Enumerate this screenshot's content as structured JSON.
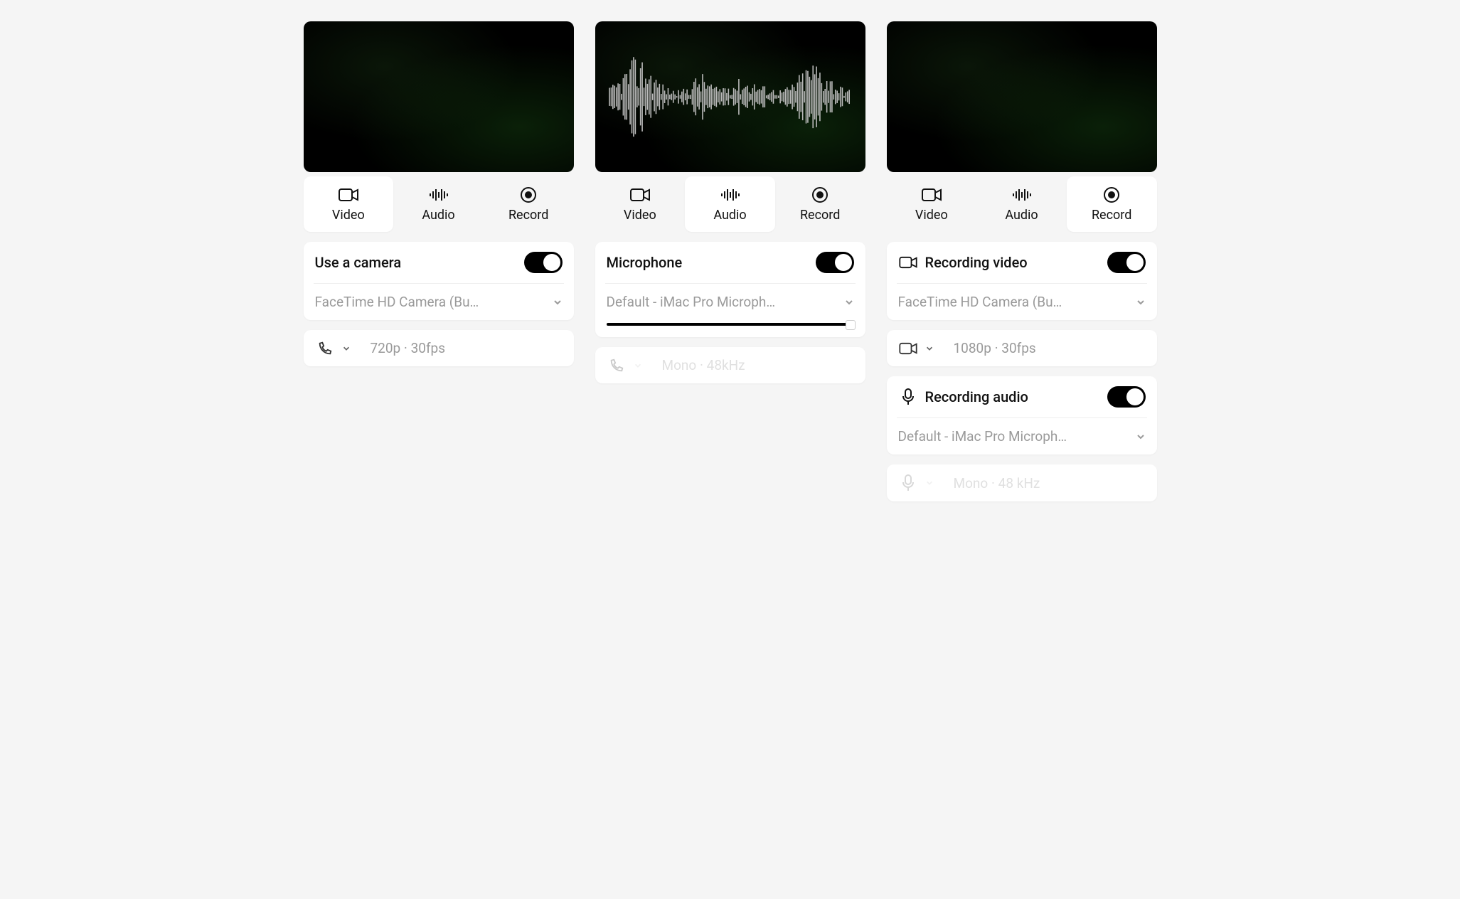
{
  "tabs": {
    "video": "Video",
    "audio": "Audio",
    "record": "Record"
  },
  "col1": {
    "active_tab": "video",
    "section_title": "Use a camera",
    "device": "FaceTime HD Camera (Bu…",
    "detail": "720p · 30fps"
  },
  "col2": {
    "active_tab": "audio",
    "section_title": "Microphone",
    "device": "Default - iMac Pro Microph…",
    "detail": "Mono · 48kHz"
  },
  "col3": {
    "active_tab": "record",
    "video_section_title": "Recording video",
    "video_device": "FaceTime HD Camera (Bu…",
    "video_detail": "1080p · 30fps",
    "audio_section_title": "Recording audio",
    "audio_device": "Default - iMac Pro Microph…",
    "audio_detail": "Mono · 48 kHz"
  }
}
